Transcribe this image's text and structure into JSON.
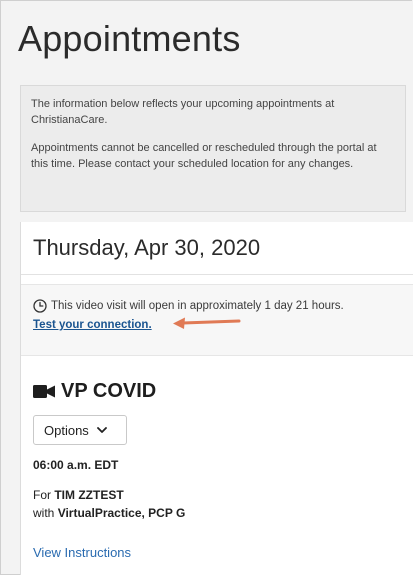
{
  "page": {
    "title": "Appointments"
  },
  "info": {
    "line1": "The information below reflects your upcoming appointments at ChristianaCare.",
    "line2": "Appointments cannot be cancelled or rescheduled through the portal at this time.  Please contact your scheduled location for any changes."
  },
  "appointment": {
    "date": "Thursday, Apr 30, 2020",
    "notice": "This video visit will open in approximately 1 day 21 hours.",
    "test_link": "Test your connection.",
    "title": "VP COVID",
    "options_label": "Options",
    "time": "06:00 a.m. EDT",
    "for_prefix": "For ",
    "patient": "TIM ZZTEST",
    "with_prefix": "with ",
    "provider": "VirtualPractice, PCP G",
    "view_instructions": "View Instructions"
  },
  "colors": {
    "link": "#1a5490",
    "arrow": "#e07a55",
    "info_bg": "#ececec"
  }
}
